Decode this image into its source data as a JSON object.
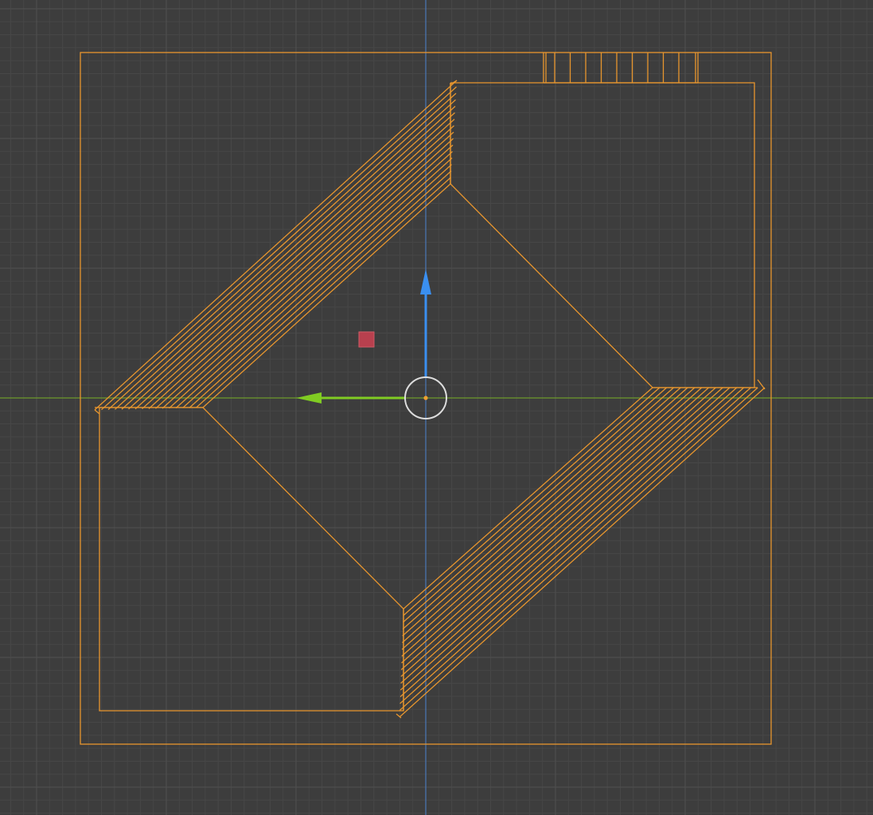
{
  "viewport": {
    "view": "top-orthographic",
    "background_color": "#3d3d3d",
    "grid": {
      "minor_line_color": "#474747",
      "major_line_color": "#4e4e4e",
      "axis_x_color": "#6e9a2c",
      "axis_y_color": "#4a78b8"
    },
    "selection_outline_color": "#e8962e",
    "object_origin_color": "#f0a030",
    "gizmo": {
      "move_x_arrow_color": "#80cc22",
      "move_y_arrow_color": "#3a8ff0",
      "pivot_circle_color": "#dddddd",
      "free_move_square_color": "#b8404e"
    }
  }
}
